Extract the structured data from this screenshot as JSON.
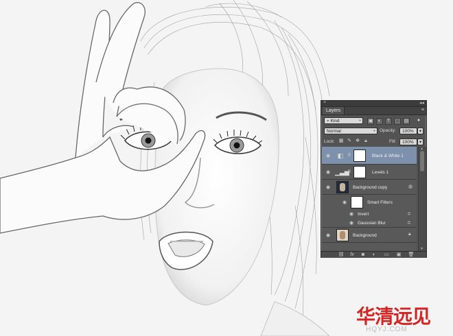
{
  "panel": {
    "close_glyph": "×",
    "collapse_glyph": "◂◂",
    "tab_label": "Layers",
    "menu_glyph": "≡",
    "filter": {
      "search_glyph": "⌕",
      "kind_label": "Kind",
      "kind_arrow": "÷"
    },
    "filter_icons": [
      "image-filter-icon",
      "adjustment-filter-icon",
      "type-filter-icon",
      "shape-filter-icon",
      "smart-object-filter-icon"
    ],
    "blend_mode": {
      "value": "Normal",
      "arrow": "÷"
    },
    "opacity": {
      "label": "Opacity:",
      "value": "100%",
      "arrow": "▾"
    },
    "lock": {
      "label": "Lock:",
      "icons": [
        "lock-transparent-icon",
        "lock-image-icon",
        "lock-position-icon",
        "lock-all-icon"
      ]
    },
    "fill": {
      "label": "Fill:",
      "value": "100%",
      "arrow": "▾"
    },
    "layers": [
      {
        "name": "Black & White 1",
        "selected": true,
        "type": "adjustment",
        "icon": "black-white-adjustment-icon"
      },
      {
        "name": "Levels 1",
        "selected": false,
        "type": "adjustment",
        "icon": "levels-adjustment-icon"
      },
      {
        "name": "Background copy",
        "selected": false,
        "type": "smart-object"
      },
      {
        "name": "Smart Filters",
        "type": "smart-filters-header"
      },
      {
        "name": "Invert",
        "type": "filter"
      },
      {
        "name": "Gaussian Blur",
        "type": "filter"
      },
      {
        "name": "Background",
        "selected": false,
        "type": "background",
        "locked": true
      }
    ],
    "footer_icons": [
      "link-layers-icon",
      "fx-icon",
      "add-mask-icon",
      "new-adjustment-icon",
      "new-group-icon",
      "new-layer-icon",
      "delete-layer-icon"
    ],
    "fx_label": "fx"
  },
  "watermark": {
    "chinese": "华清远见",
    "url": "HQYJ.COM"
  },
  "colors": {
    "selected_layer": "#7d91ad",
    "panel_bg": "#535353",
    "watermark_red": "#d42525"
  }
}
